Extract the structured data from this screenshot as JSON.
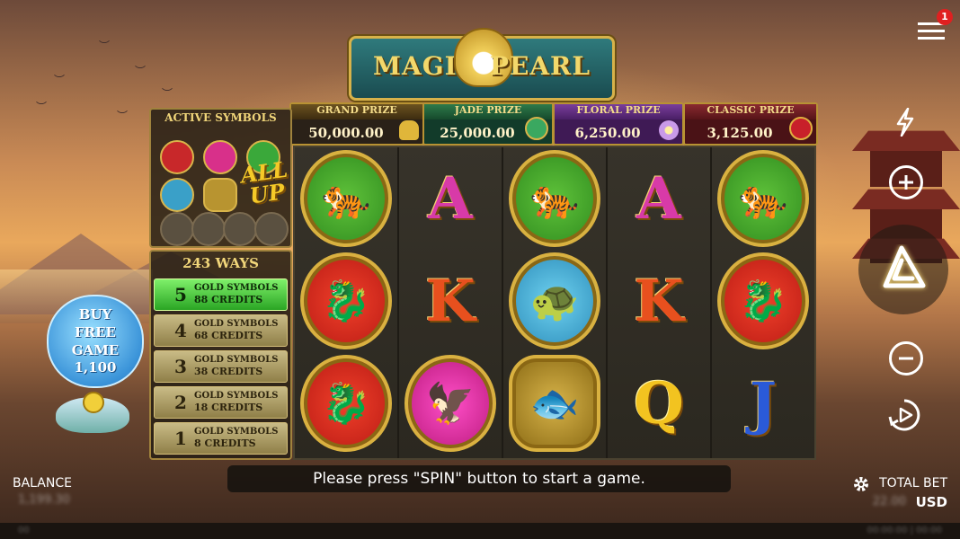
{
  "logo": {
    "word1": "MAGIC",
    "word2": "PEARL"
  },
  "prizes": [
    {
      "label": "GRAND PRIZE",
      "value": "50,000.00",
      "icon": "gold-ingot-icon",
      "color": "#2b241a"
    },
    {
      "label": "JADE PRIZE",
      "value": "25,000.00",
      "icon": "jade-coin-icon",
      "color": "#123b2a"
    },
    {
      "label": "FLORAL PRIZE",
      "value": "6,250.00",
      "icon": "flower-icon",
      "color": "#3f1a55"
    },
    {
      "label": "CLASSIC PRIZE",
      "value": "3,125.00",
      "icon": "red-lantern-icon",
      "color": "#4a1216"
    }
  ],
  "active_symbols": {
    "title": "ACTIVE SYMBOLS",
    "badge": "ALL UP"
  },
  "ways": {
    "title": "243 WAYS",
    "rows": [
      {
        "count": "5",
        "line1": "GOLD SYMBOLS",
        "line2": "88 CREDITS",
        "active": true
      },
      {
        "count": "4",
        "line1": "GOLD SYMBOLS",
        "line2": "68 CREDITS",
        "active": false
      },
      {
        "count": "3",
        "line1": "GOLD SYMBOLS",
        "line2": "38 CREDITS",
        "active": false
      },
      {
        "count": "2",
        "line1": "GOLD SYMBOLS",
        "line2": "18 CREDITS",
        "active": false
      },
      {
        "count": "1",
        "line1": "GOLD SYMBOLS",
        "line2": "8 CREDITS",
        "active": false
      }
    ]
  },
  "reels": [
    [
      "tiger",
      "dragon-red",
      "dragon-red"
    ],
    [
      "A",
      "K",
      "phoenix"
    ],
    [
      "tiger",
      "turtle",
      "koi-fish"
    ],
    [
      "A",
      "K",
      "Q"
    ],
    [
      "tiger",
      "dragon-red",
      "J"
    ]
  ],
  "buy_feature": {
    "line1": "BUY",
    "line2": "FREE",
    "line3": "GAME",
    "price": "1,100"
  },
  "message": "Please press \"SPIN\" button to start a game.",
  "balance": {
    "label": "BALANCE",
    "value": "1,199.30"
  },
  "total_bet": {
    "label": "TOTAL BET",
    "currency": "USD",
    "value": "22.00"
  },
  "menu": {
    "badge": "1"
  },
  "footer": {
    "left": "00",
    "right": "00:00:00 | 00:00"
  }
}
